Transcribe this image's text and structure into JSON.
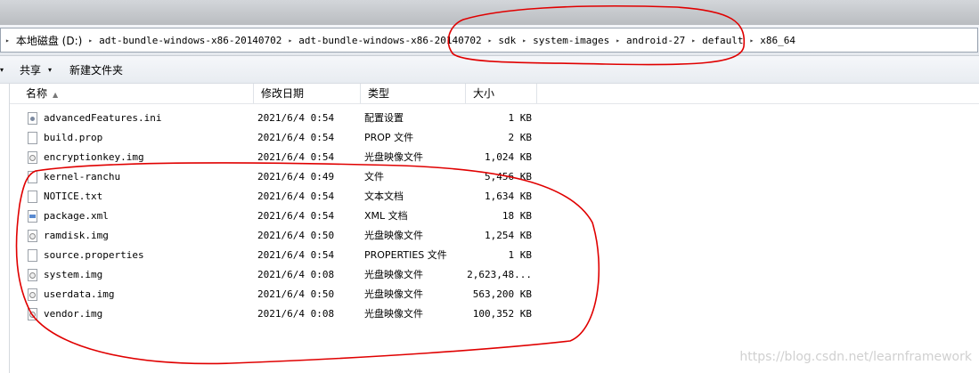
{
  "address": {
    "crumbs": [
      "本地磁盘 (D:)",
      "adt-bundle-windows-x86-20140702",
      "adt-bundle-windows-x86-20140702",
      "sdk",
      "system-images",
      "android-27",
      "default",
      "x86_64"
    ]
  },
  "toolbar": {
    "share_label": "共享",
    "new_folder_label": "新建文件夹"
  },
  "columns": {
    "name": "名称",
    "modified": "修改日期",
    "type": "类型",
    "size": "大小"
  },
  "files": [
    {
      "name": "advancedFeatures.ini",
      "modified": "2021/6/4 0:54",
      "type": "配置设置",
      "size": "1 KB",
      "icon": "settings-file-icon"
    },
    {
      "name": "build.prop",
      "modified": "2021/6/4 0:54",
      "type": "PROP 文件",
      "size": "2 KB",
      "icon": "file-icon"
    },
    {
      "name": "encryptionkey.img",
      "modified": "2021/6/4 0:54",
      "type": "光盘映像文件",
      "size": "1,024 KB",
      "icon": "disc-image-icon"
    },
    {
      "name": "kernel-ranchu",
      "modified": "2021/6/4 0:49",
      "type": "文件",
      "size": "5,456 KB",
      "icon": "file-icon"
    },
    {
      "name": "NOTICE.txt",
      "modified": "2021/6/4 0:54",
      "type": "文本文档",
      "size": "1,634 KB",
      "icon": "text-file-icon"
    },
    {
      "name": "package.xml",
      "modified": "2021/6/4 0:54",
      "type": "XML 文档",
      "size": "18 KB",
      "icon": "xml-file-icon"
    },
    {
      "name": "ramdisk.img",
      "modified": "2021/6/4 0:50",
      "type": "光盘映像文件",
      "size": "1,254 KB",
      "icon": "disc-image-icon"
    },
    {
      "name": "source.properties",
      "modified": "2021/6/4 0:54",
      "type": "PROPERTIES 文件",
      "size": "1 KB",
      "icon": "file-icon"
    },
    {
      "name": "system.img",
      "modified": "2021/6/4 0:08",
      "type": "光盘映像文件",
      "size": "2,623,48...",
      "icon": "disc-image-icon"
    },
    {
      "name": "userdata.img",
      "modified": "2021/6/4 0:50",
      "type": "光盘映像文件",
      "size": "563,200 KB",
      "icon": "disc-image-icon"
    },
    {
      "name": "vendor.img",
      "modified": "2021/6/4 0:08",
      "type": "光盘映像文件",
      "size": "100,352 KB",
      "icon": "disc-image-icon"
    }
  ],
  "watermark": "https://blog.csdn.net/learnframework",
  "colors": {
    "annotation": "#e00000"
  }
}
